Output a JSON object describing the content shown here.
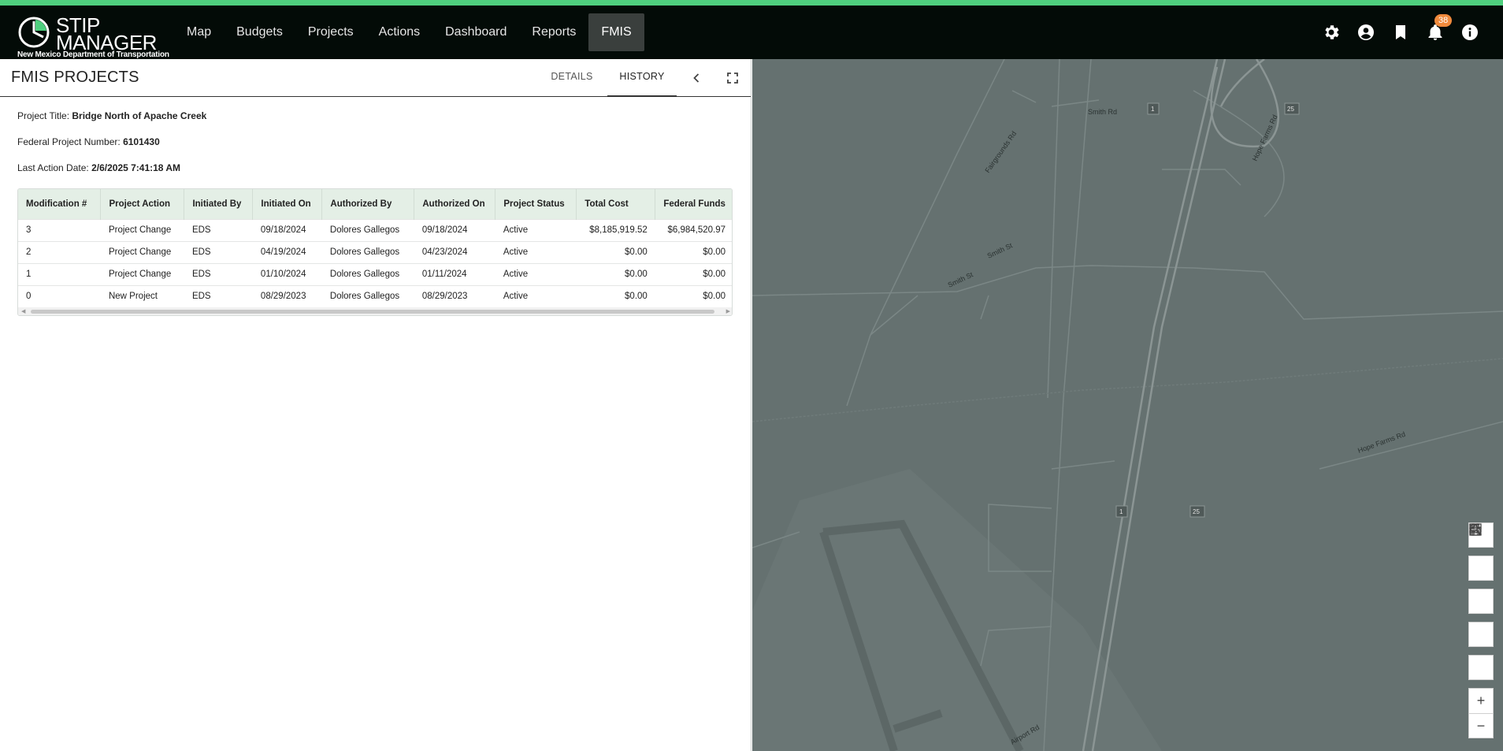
{
  "app": {
    "brand_line1": "STIP",
    "brand_line2": "MANAGER",
    "brand_sub": "New Mexico Department of Transportation",
    "accent_color": "#4fcf7e"
  },
  "nav": {
    "items": [
      {
        "label": "Map"
      },
      {
        "label": "Budgets"
      },
      {
        "label": "Projects"
      },
      {
        "label": "Actions"
      },
      {
        "label": "Dashboard"
      },
      {
        "label": "Reports"
      },
      {
        "label": "FMIS"
      }
    ],
    "active": "FMIS"
  },
  "topbar_icons": {
    "settings": "gear-icon",
    "account": "account-circle-icon",
    "bookmark": "bookmark-icon",
    "notifications": "bell-icon",
    "notification_count": "38",
    "info": "info-icon"
  },
  "panel": {
    "title": "FMIS PROJECTS",
    "tabs": [
      {
        "label": "DETAILS"
      },
      {
        "label": "HISTORY"
      }
    ],
    "active_tab": "HISTORY"
  },
  "project": {
    "title_label": "Project Title:",
    "title_value": "Bridge North of Apache Creek",
    "fpn_label": "Federal Project Number:",
    "fpn_value": "6101430",
    "last_action_label": "Last Action Date:",
    "last_action_value": "2/6/2025 7:41:18 AM"
  },
  "history_table": {
    "columns": [
      "Modification #",
      "Project Action",
      "Initiated By",
      "Initiated On",
      "Authorized By",
      "Authorized On",
      "Project Status",
      "Total Cost",
      "Federal Funds"
    ],
    "rows": [
      [
        "3",
        "Project Change",
        "EDS",
        "09/18/2024",
        "Dolores Gallegos",
        "09/18/2024",
        "Active",
        "$8,185,919.52",
        "$6,984,520.97"
      ],
      [
        "2",
        "Project Change",
        "EDS",
        "04/19/2024",
        "Dolores Gallegos",
        "04/23/2024",
        "Active",
        "$0.00",
        "$0.00"
      ],
      [
        "1",
        "Project Change",
        "EDS",
        "01/10/2024",
        "Dolores Gallegos",
        "01/11/2024",
        "Active",
        "$0.00",
        "$0.00"
      ],
      [
        "0",
        "New Project",
        "EDS",
        "08/29/2023",
        "Dolores Gallegos",
        "08/29/2023",
        "Active",
        "$0.00",
        "$0.00"
      ]
    ]
  },
  "map": {
    "labels": {
      "smith_rd": "Smith Rd",
      "smith_st_a": "Smith St",
      "smith_st_b": "Smith St",
      "fairgrounds_rd": "Fairgrounds Rd",
      "hope_farms_rd_a": "Hope Farms Rd",
      "hope_farms_rd_b": "Hope Farms Rd",
      "airport_rd": "Airport Rd",
      "route_1": "1",
      "route_25": "25"
    },
    "tools": [
      "search-icon",
      "list-icon",
      "qr-code-icon",
      "print-icon",
      "home-icon",
      "zoom-in-icon",
      "zoom-out-icon"
    ],
    "zoom_in": "+",
    "zoom_out": "−"
  }
}
